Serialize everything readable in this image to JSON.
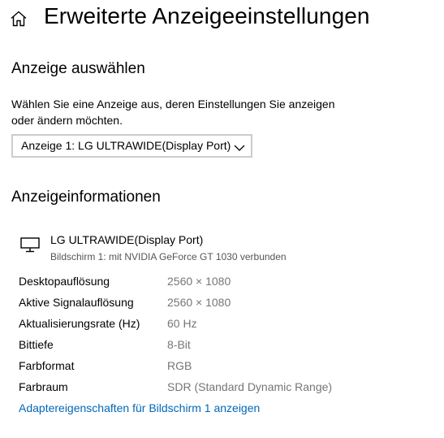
{
  "header": {
    "title": "Erweiterte Anzeigeeinstellungen",
    "home_icon": "home-icon"
  },
  "select_display": {
    "heading": "Anzeige auswählen",
    "description": "Wählen Sie eine Anzeige aus, deren Einstellungen Sie anzeigen oder ändern möchten.",
    "selected_value": "Anzeige 1: LG ULTRAWIDE(Display Port)",
    "chevron_icon": "chevron-down-icon"
  },
  "display_info": {
    "heading": "Anzeigeinformationen",
    "monitor_icon": "monitor-icon",
    "monitor_name": "LG ULTRAWIDE(Display Port)",
    "monitor_subtitle": "Bildschirm 1: mit NVIDIA GeForce GT 1030 verbunden",
    "rows": [
      {
        "label": "Desktopauflösung",
        "value": "2560 × 1080"
      },
      {
        "label": "Aktive Signalauflösung",
        "value": "2560 × 1080"
      },
      {
        "label": "Aktualisierungsrate (Hz)",
        "value": "60 Hz"
      },
      {
        "label": "Bittiefe",
        "value": "8-Bit"
      },
      {
        "label": "Farbformat",
        "value": "RGB"
      },
      {
        "label": "Farbraum",
        "value": "SDR (Standard Dynamic Range)"
      }
    ],
    "adapter_link": "Adaptereigenschaften für Bildschirm 1 anzeigen"
  },
  "colors": {
    "link": "#0067b8",
    "secondary_text": "#767676",
    "select_border": "#cccccc"
  }
}
